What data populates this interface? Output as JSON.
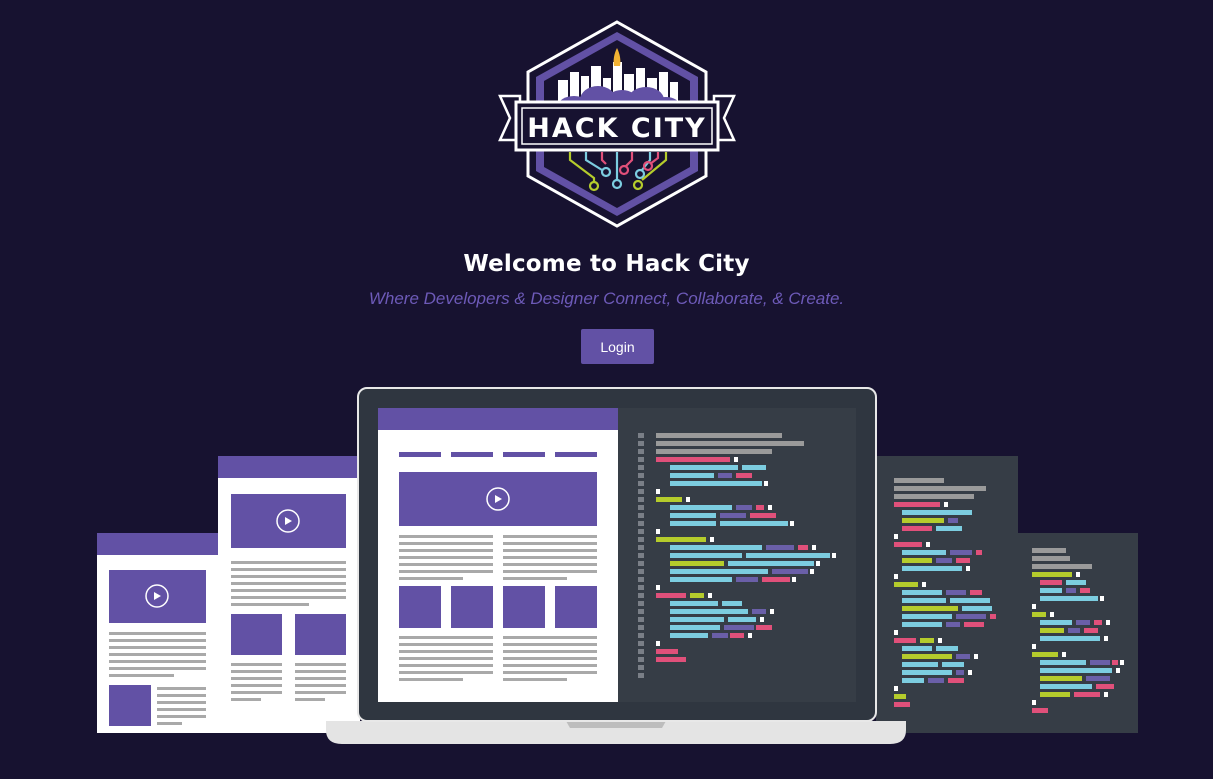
{
  "logo": {
    "text": "HACK CITY"
  },
  "hero": {
    "title": "Welcome to Hack City",
    "subtitle": "Where Developers & Designer Connect, Collaborate, & Create."
  },
  "actions": {
    "login_label": "Login"
  },
  "colors": {
    "background": "#171230",
    "accent": "#6251a5",
    "subtitle": "#6d5ab8",
    "code_pink": "#e0507a",
    "code_green": "#b5cc2c",
    "code_cyan": "#7ccde0",
    "code_purple": "#6a5fa8",
    "code_gray": "#9a9a9a",
    "panel_dark": "#363d46"
  }
}
